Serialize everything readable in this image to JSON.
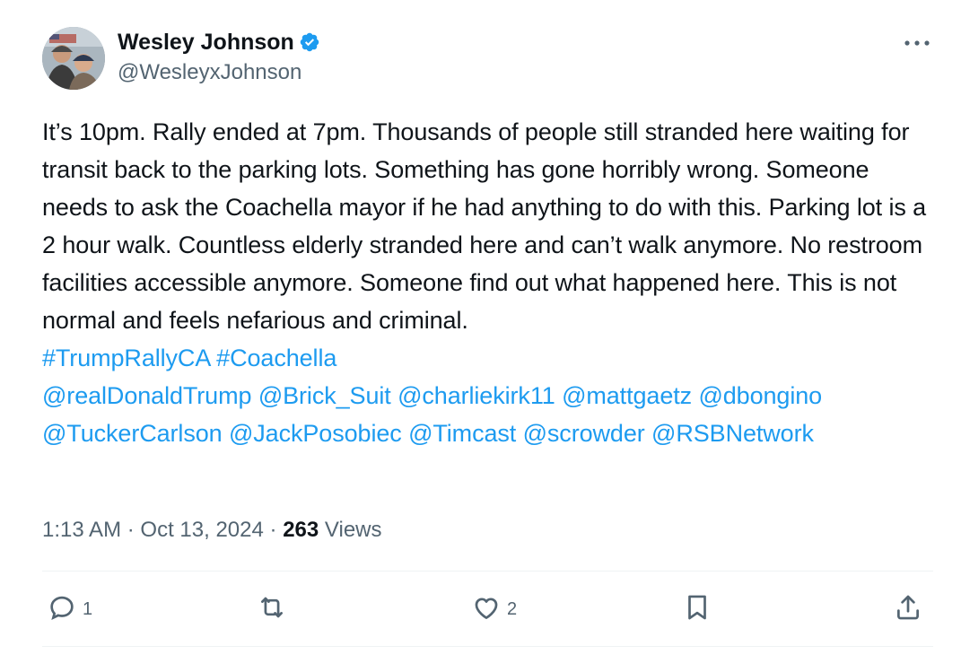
{
  "author": {
    "display_name": "Wesley Johnson",
    "handle": "@WesleyxJohnson",
    "verified": true
  },
  "body": {
    "text": "It’s 10pm. Rally ended at 7pm. Thousands of people still stranded here waiting for transit back to the parking lots. Something has gone horribly wrong. Someone needs to ask the Coachella mayor if he had anything to do with this. Parking lot is a 2 hour walk. Countless elderly stranded here and can’t walk anymore. No restroom facilities accessible anymore. Someone find out what happened here. This is not normal and feels nefarious and criminal.",
    "hashtags": [
      "#TrumpRallyCA",
      "#Coachella"
    ],
    "mentions": [
      "@realDonaldTrump",
      "@Brick_Suit",
      "@charliekirk11",
      "@mattgaetz",
      "@dbongino",
      "@TuckerCarlson",
      "@JackPosobiec",
      "@Timcast",
      "@scrowder",
      "@RSBNetwork"
    ]
  },
  "meta": {
    "time": "1:13 AM",
    "date": "Oct 13, 2024",
    "separator": "·",
    "views_count": "263",
    "views_label": "Views"
  },
  "actions": {
    "reply_count": "1",
    "like_count": "2"
  },
  "colors": {
    "link": "#1d9bf0",
    "secondary_text": "#536471",
    "primary_text": "#0f1419",
    "verified_badge": "#1d9bf0"
  },
  "icons": [
    "verified-badge-icon",
    "more-icon",
    "reply-icon",
    "retweet-icon",
    "like-icon",
    "bookmark-icon",
    "share-icon"
  ]
}
